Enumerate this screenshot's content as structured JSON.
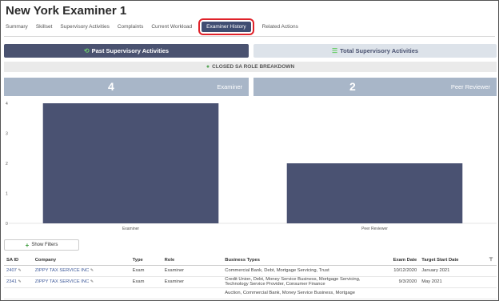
{
  "page": {
    "title": "New York Examiner 1"
  },
  "tabs": [
    {
      "label": "Summary"
    },
    {
      "label": "Skillset"
    },
    {
      "label": "Supervisory Activities"
    },
    {
      "label": "Complaints"
    },
    {
      "label": "Current Workload"
    },
    {
      "label": "Examiner History",
      "active": true
    },
    {
      "label": "Related Actions"
    }
  ],
  "toggles": {
    "past_label": "Past Supervisory Activities",
    "total_label": "Total Supervisory Activities"
  },
  "section": {
    "title": "CLOSED SA ROLE BREAKDOWN"
  },
  "stats": [
    {
      "value": "4",
      "label": "Examiner"
    },
    {
      "value": "2",
      "label": "Peer Reviewer"
    }
  ],
  "chart_data": {
    "type": "bar",
    "categories": [
      "Examiner",
      "Peer Reviewer"
    ],
    "values": [
      4,
      2
    ],
    "y_ticks": [
      0,
      1,
      2,
      3,
      4
    ],
    "ylim": [
      0,
      4
    ],
    "bar_color": "#4a5272"
  },
  "filters": {
    "show_label": "Show Filters"
  },
  "table": {
    "headers": [
      "SA ID",
      "Company",
      "Type",
      "Role",
      "Business Types",
      "Exam Date",
      "Target Start Date"
    ],
    "rows": [
      {
        "sa_id": "2407",
        "company": "ZIPPY TAX SERVICE INC",
        "type": "Exam",
        "role": "Examiner",
        "business_types": "Commercial Bank, Debt, Mortgage Servicing, Trust",
        "exam_date": "10/12/2020",
        "target_start": "January 2021"
      },
      {
        "sa_id": "2341",
        "company": "ZIPPY TAX SERVICE INC",
        "type": "Exam",
        "role": "Examiner",
        "business_types": "Credit Union, Debt, Money Service Business, Mortgage Servicing, Technology Service Provider, Consumer Finance",
        "exam_date": "9/3/2020",
        "target_start": "May 2021"
      },
      {
        "sa_id": "",
        "company": "",
        "type": "",
        "role": "",
        "business_types": "Auction, Commercial Bank, Money Service Business, Mortgage",
        "exam_date": "",
        "target_start": ""
      }
    ]
  },
  "colors": {
    "accent": "#3f4d72",
    "highlight": "#e0222a",
    "stat_bg": "#a8b6c8"
  }
}
